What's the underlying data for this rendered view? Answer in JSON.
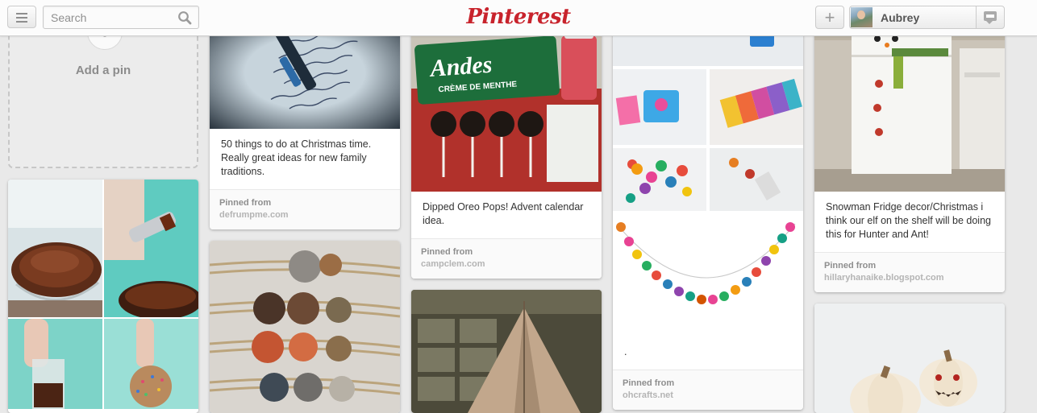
{
  "header": {
    "logo": "Pinterest",
    "search_placeholder": "Search",
    "user_name": "Aubrey"
  },
  "add_pin": {
    "label": "Add a pin"
  },
  "pins": [
    {
      "description": "50 things to do at Christmas time. Really great ideas for new family traditions.",
      "pinned_from_label": "Pinned from",
      "source": "defrumpme.com"
    },
    {
      "description": "Dipped Oreo Pops! Advent calendar idea.",
      "pinned_from_label": "Pinned from",
      "source": "campclem.com",
      "package_brand": "Andes",
      "package_flavor": "CRÈME DE MENTHE"
    },
    {
      "description": ".",
      "pinned_from_label": "Pinned from",
      "source": "ohcrafts.net"
    },
    {
      "description": "Snowman Fridge decor/Christmas i think our elf on the shelf will be doing this for Hunter and Ant!",
      "pinned_from_label": "Pinned from",
      "source": "hillaryhanaike.blogspot.com"
    }
  ],
  "colors": {
    "brand_red": "#c8232c",
    "background": "#e9e9e9"
  },
  "icons": [
    "menu-icon",
    "search-icon",
    "plus-icon",
    "notifications-icon",
    "avatar"
  ]
}
